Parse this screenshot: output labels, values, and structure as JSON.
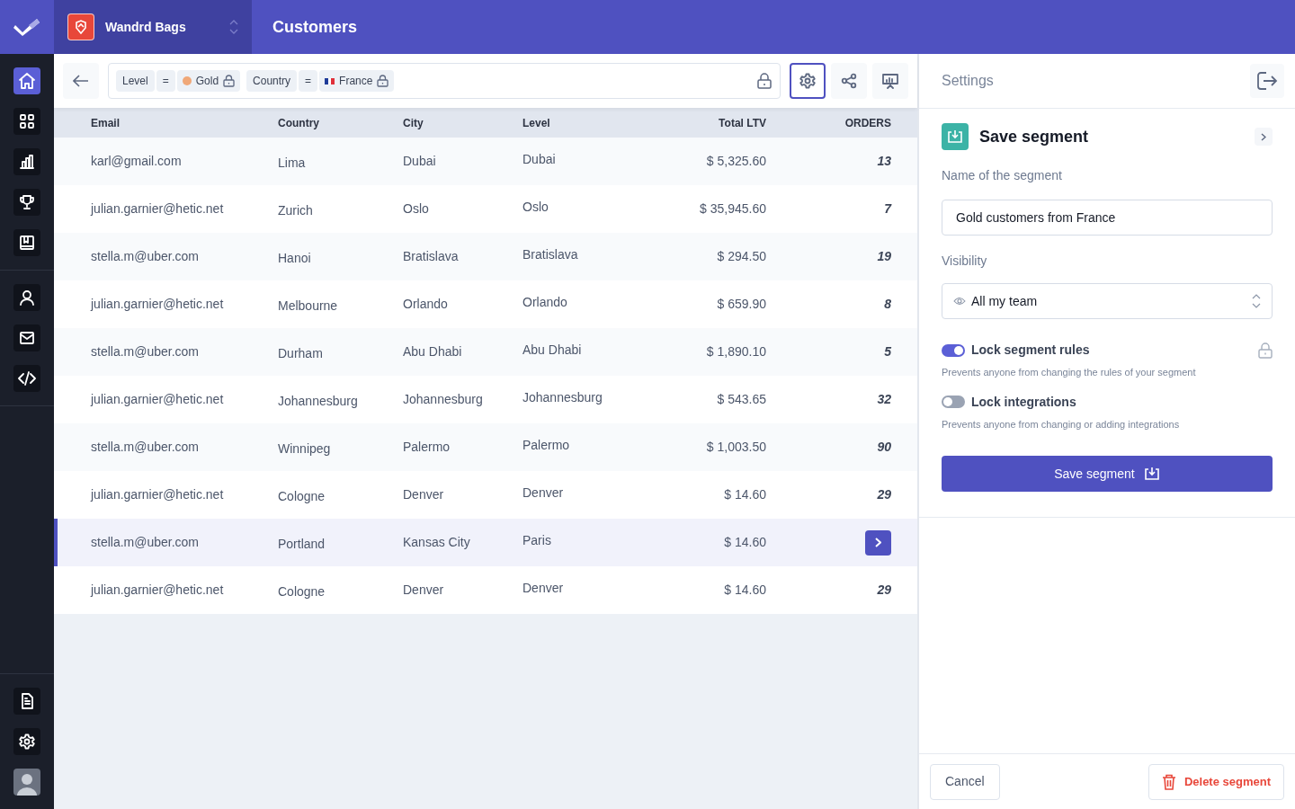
{
  "workspace": {
    "name": "Wandrd Bags"
  },
  "page_title": "Customers",
  "sidebar": {
    "top": [
      {
        "kind": "home",
        "selected": true
      },
      {
        "kind": "grid",
        "selected": false
      },
      {
        "kind": "chart",
        "selected": false
      },
      {
        "kind": "trophy",
        "selected": false
      },
      {
        "kind": "book",
        "selected": false
      }
    ],
    "middle": [
      {
        "kind": "user",
        "selected": false
      },
      {
        "kind": "mail",
        "selected": false
      },
      {
        "kind": "code",
        "selected": false
      }
    ],
    "bottom": [
      {
        "kind": "doc",
        "selected": false
      },
      {
        "kind": "gear",
        "selected": false
      }
    ],
    "avatar": true
  },
  "filters": [
    {
      "field": "Level",
      "operator": "=",
      "value": "Gold",
      "kind": "dot",
      "color": "#f0a878"
    },
    {
      "field": "Country",
      "operator": "=",
      "value": "France",
      "kind": "flag"
    }
  ],
  "toolbar": [
    {
      "kind": "gear",
      "selected": true
    },
    {
      "kind": "share",
      "selected": false
    },
    {
      "kind": "presentation",
      "selected": false
    }
  ],
  "table": {
    "columns": [
      "Email",
      "Country",
      "City",
      "Level",
      "Total LTV",
      "ORDERS"
    ],
    "rows": [
      {
        "email": "karl@gmail.com",
        "country": "Lima",
        "city": "Dubai",
        "level": "Dubai",
        "total": "$ 5,325.60",
        "orders": "13",
        "selected": false
      },
      {
        "email": "julian.garnier@hetic.net",
        "country": "Zurich",
        "city": "Oslo",
        "level": "Oslo",
        "total": "$ 35,945.60",
        "orders": "7",
        "selected": false
      },
      {
        "email": "stella.m@uber.com",
        "country": "Hanoi",
        "city": "Bratislava",
        "level": "Bratislava",
        "total": "$ 294.50",
        "orders": "19",
        "selected": false
      },
      {
        "email": "julian.garnier@hetic.net",
        "country": "Melbourne",
        "city": "Orlando",
        "level": "Orlando",
        "total": "$ 659.90",
        "orders": "8",
        "selected": false
      },
      {
        "email": "stella.m@uber.com",
        "country": "Durham",
        "city": "Abu Dhabi",
        "level": "Abu Dhabi",
        "total": "$ 1,890.10",
        "orders": "5",
        "selected": false
      },
      {
        "email": "julian.garnier@hetic.net",
        "country": "Johannesburg",
        "city": "Johannesburg",
        "level": "Johannesburg",
        "total": "$ 543.65",
        "orders": "32",
        "selected": false
      },
      {
        "email": "stella.m@uber.com",
        "country": "Winnipeg",
        "city": "Palermo",
        "level": "Palermo",
        "total": "$ 1,003.50",
        "orders": "90",
        "selected": false
      },
      {
        "email": "julian.garnier@hetic.net",
        "country": "Cologne",
        "city": "Denver",
        "level": "Denver",
        "total": "$ 14.60",
        "orders": "29",
        "selected": false
      },
      {
        "email": "stella.m@uber.com",
        "country": "Portland",
        "city": "Kansas City",
        "level": "Paris",
        "total": "$ 14.60",
        "selected": true
      },
      {
        "email": "julian.garnier@hetic.net",
        "country": "Cologne",
        "city": "Denver",
        "level": "Denver",
        "total": "$ 14.60",
        "orders": "29",
        "selected": false
      }
    ]
  },
  "settings": {
    "title": "Settings",
    "section_title": "Save segment",
    "name_label": "Name of the segment",
    "name_value": "Gold customers from France",
    "visibility_label": "Visibility",
    "visibility_value": "All my team",
    "toggles": [
      {
        "label": "Lock segment rules",
        "description": "Prevents anyone from changing the rules of your segment",
        "on": true,
        "locked": true
      },
      {
        "label": "Lock integrations",
        "description": "Prevents anyone from changing or adding integrations",
        "on": false,
        "locked": false
      }
    ],
    "save_button": "Save segment",
    "cancel_button": "Cancel",
    "delete_button": "Delete segment"
  }
}
